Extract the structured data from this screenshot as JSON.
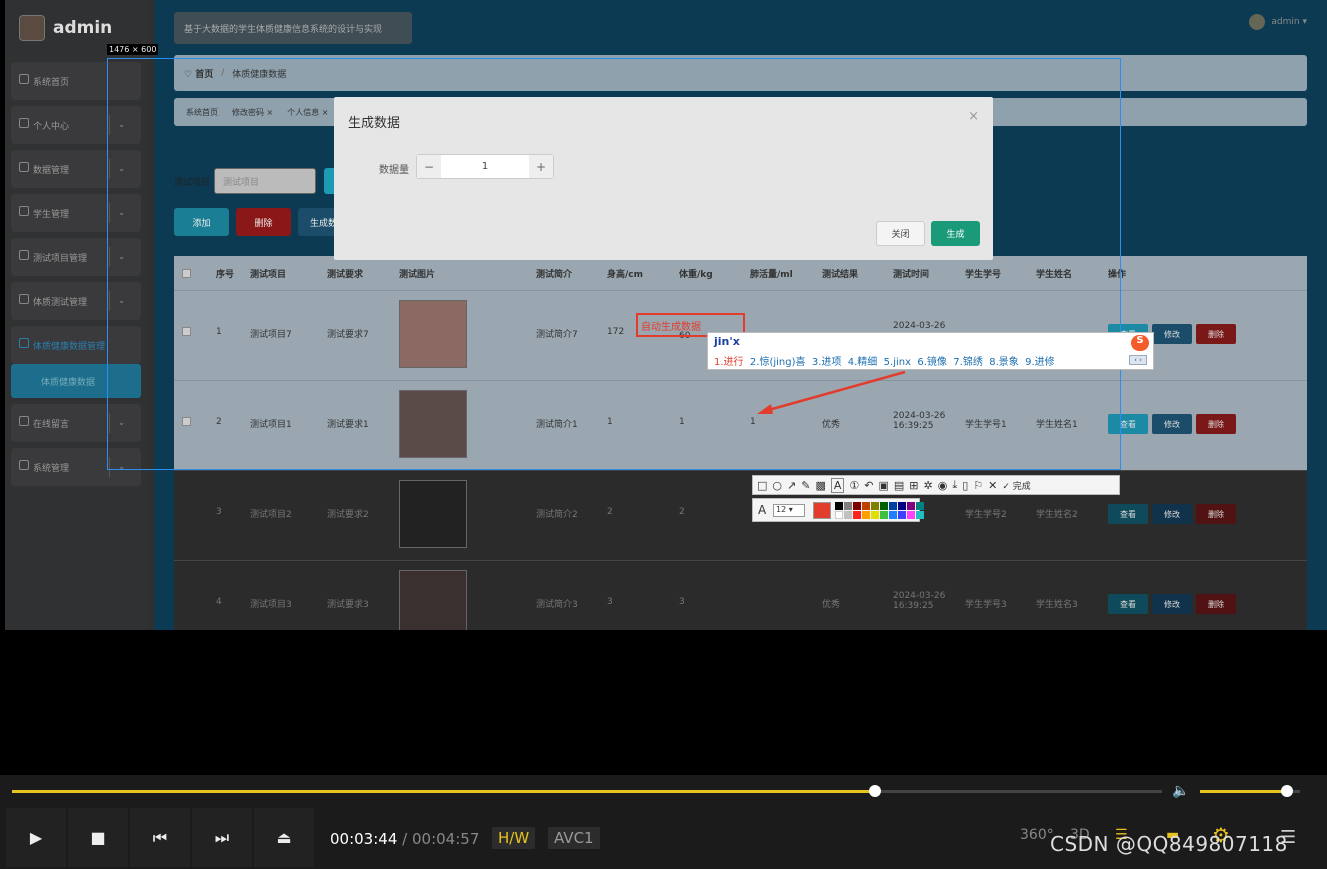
{
  "app": {
    "user": "admin",
    "system_title": "基于大数据的学生体质健康信息系统的设计与实现",
    "header_user": "admin"
  },
  "sidebar": {
    "items": [
      {
        "label": "系统首页"
      },
      {
        "label": "个人中心"
      },
      {
        "label": "数据管理"
      },
      {
        "label": "学生管理"
      },
      {
        "label": "测试项目管理"
      },
      {
        "label": "体质测试管理"
      },
      {
        "label": "体质健康数据管理"
      },
      {
        "label": "在线留言"
      },
      {
        "label": "系统管理"
      }
    ],
    "sub_item": "体质健康数据"
  },
  "breadcrumb": {
    "home": "♡ 首页",
    "sep": "/",
    "current": "体质健康数据"
  },
  "tabs": [
    "系统首页",
    "修改密码 ×",
    "个人信息 ×"
  ],
  "search": {
    "label": "测试项目",
    "placeholder": "测试项目"
  },
  "actions": {
    "add": "添加",
    "delete": "删除",
    "generate": "生成数据"
  },
  "table": {
    "headers": [
      "序号",
      "测试项目",
      "测试要求",
      "测试图片",
      "测试简介",
      "身高/cm",
      "体重/kg",
      "肺活量/ml",
      "测试结果",
      "测试时间",
      "学生学号",
      "学生姓名",
      "操作"
    ],
    "rows": [
      {
        "no": "1",
        "item": "测试项目7",
        "req": "测试要求7",
        "intro": "测试简介7",
        "height": "172",
        "weight": "60",
        "lung": "",
        "result": "",
        "time": "2024-03-26",
        "sid": "",
        "sname": ""
      },
      {
        "no": "2",
        "item": "测试项目1",
        "req": "测试要求1",
        "intro": "测试简介1",
        "height": "1",
        "weight": "1",
        "lung": "1",
        "result": "优秀",
        "time": "2024-03-26 16:39:25",
        "sid": "学生学号1",
        "sname": "学生姓名1"
      },
      {
        "no": "3",
        "item": "测试项目2",
        "req": "测试要求2",
        "intro": "测试简介2",
        "height": "2",
        "weight": "2",
        "lung": "",
        "result": "",
        "time": "",
        "sid": "学生学号2",
        "sname": "学生姓名2"
      },
      {
        "no": "4",
        "item": "测试项目3",
        "req": "测试要求3",
        "intro": "测试简介3",
        "height": "3",
        "weight": "3",
        "lung": "",
        "result": "优秀",
        "time": "2024-03-26 16:39:25",
        "sid": "学生学号3",
        "sname": "学生姓名3"
      }
    ],
    "row_actions": {
      "view": "查看",
      "edit": "修改",
      "del": "删除"
    }
  },
  "modal": {
    "title": "生成数据",
    "close_x": "×",
    "field_label": "数据量",
    "value": "1",
    "minus": "−",
    "plus": "+",
    "cancel": "关闭",
    "confirm": "生成"
  },
  "screenshot_tool": {
    "size_label": "1476 × 600",
    "annotation": "自动生成数据",
    "font_size": "12",
    "finish": "完成"
  },
  "ime": {
    "composition": "jin'x",
    "candidates": [
      "1.进行",
      "2.惊(jing)喜",
      "3.进项",
      "4.精细",
      "5.jinx",
      "6.镜像",
      "7.锦绣",
      "8.景象",
      "9.进修"
    ]
  },
  "player": {
    "time_current": "00:03:44",
    "time_sep": "/",
    "time_total": "00:04:57",
    "hw": "H/W",
    "codec": "AVC1",
    "progress": 0.75,
    "volume": 0.87,
    "icon_360": "360°",
    "icon_3d": "3D"
  },
  "watermark": "CSDN @QQ849807118",
  "colors": {
    "accent": "#e8c21e",
    "primary": "#1d9bb5",
    "danger": "#c0392b",
    "modal_ok": "#1a9a78"
  }
}
